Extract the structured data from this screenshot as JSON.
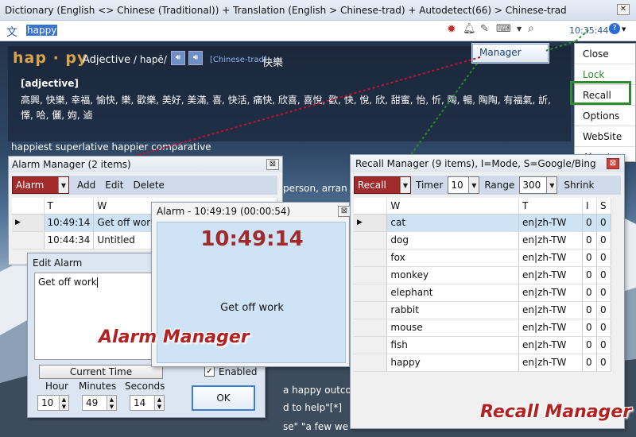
{
  "window": {
    "title": "Dictionary (English <> Chinese (Traditional)) + Translation (English > Chinese-trad) + Autodetect(66) > Chinese-trad",
    "close_glyph": "✕"
  },
  "search": {
    "value": "happy",
    "time": "10:35:44",
    "help": "?"
  },
  "entry": {
    "word": "hap · py",
    "pos": "Adjective",
    "phonetic": "/ hapē/",
    "lang_tag": "[Chinese-trad]",
    "translation": "快樂",
    "section": "[adjective]",
    "synonyms_line1": "高興, 快樂, 幸福, 愉快, 樂, 歡樂, 美好, 美滿, 喜, 快活, 痛快, 欣喜, 喜悅, 歡, 快, 悅, 欣, 甜蜜, 怡, 忻, 陶, 暢, 陶陶, 有福氣, 訢,",
    "synonyms_line2": "懌, 哈, 儷, 姁, 逌",
    "forms": "happiest superlative happier comparative",
    "frag_person": "person, arran",
    "frag_outcome": "a happy outco",
    "frag_help": "d to help\"[*]",
    "frag_few": "se\" \"a few we"
  },
  "tooltip": {
    "manager": "Manager"
  },
  "context_menu": {
    "items": [
      "Close",
      "Lock",
      "Recall",
      "Options",
      "WebSite",
      "About"
    ]
  },
  "alarm_manager": {
    "title": "Alarm Manager (2 items)",
    "mode": "Alarm",
    "toolbar": [
      "Add",
      "Edit",
      "Delete"
    ],
    "headers": [
      "T",
      "W"
    ],
    "rows": [
      {
        "t": "10:49:14",
        "w": "Get off work"
      },
      {
        "t": "10:44:34",
        "w": "Untitled"
      }
    ]
  },
  "edit_alarm": {
    "title": "Edit Alarm",
    "text": "Get off work",
    "current_time": "Current Time",
    "enabled_label": "Enabled",
    "hour_label": "Hour",
    "hour": "10",
    "minutes_label": "Minutes",
    "minutes": "49",
    "seconds_label": "Seconds",
    "seconds": "14",
    "ok": "OK"
  },
  "alarm_popup": {
    "title": "Alarm - 10:49:19 (00:00:54)",
    "time": "10:49:14",
    "message": "Get off work"
  },
  "recall_manager": {
    "title": "Recall Manager (9 items), I=Mode, S=Google/Bing",
    "mode": "Recall",
    "timer_label": "Timer",
    "timer": "10",
    "range_label": "Range",
    "range": "300",
    "shrink": "Shrink",
    "headers": [
      "W",
      "T",
      "I",
      "S"
    ],
    "rows": [
      {
        "w": "cat",
        "t": "en|zh-TW",
        "i": "0",
        "s": "0"
      },
      {
        "w": "dog",
        "t": "en|zh-TW",
        "i": "0",
        "s": "0"
      },
      {
        "w": "fox",
        "t": "en|zh-TW",
        "i": "0",
        "s": "0"
      },
      {
        "w": "monkey",
        "t": "en|zh-TW",
        "i": "0",
        "s": "0"
      },
      {
        "w": "elephant",
        "t": "en|zh-TW",
        "i": "0",
        "s": "0"
      },
      {
        "w": "rabbit",
        "t": "en|zh-TW",
        "i": "0",
        "s": "0"
      },
      {
        "w": "mouse",
        "t": "en|zh-TW",
        "i": "0",
        "s": "0"
      },
      {
        "w": "fish",
        "t": "en|zh-TW",
        "i": "0",
        "s": "0"
      },
      {
        "w": "happy",
        "t": "en|zh-TW",
        "i": "0",
        "s": "0"
      }
    ]
  },
  "annotations": {
    "alarm": "Alarm Manager",
    "recall": "Recall Manager"
  },
  "colors": {
    "accent_red": "#a12a2a",
    "annotation_red": "#b22222",
    "highlight_green": "#2e8b2e",
    "selected_row": "#cfe3f7"
  }
}
